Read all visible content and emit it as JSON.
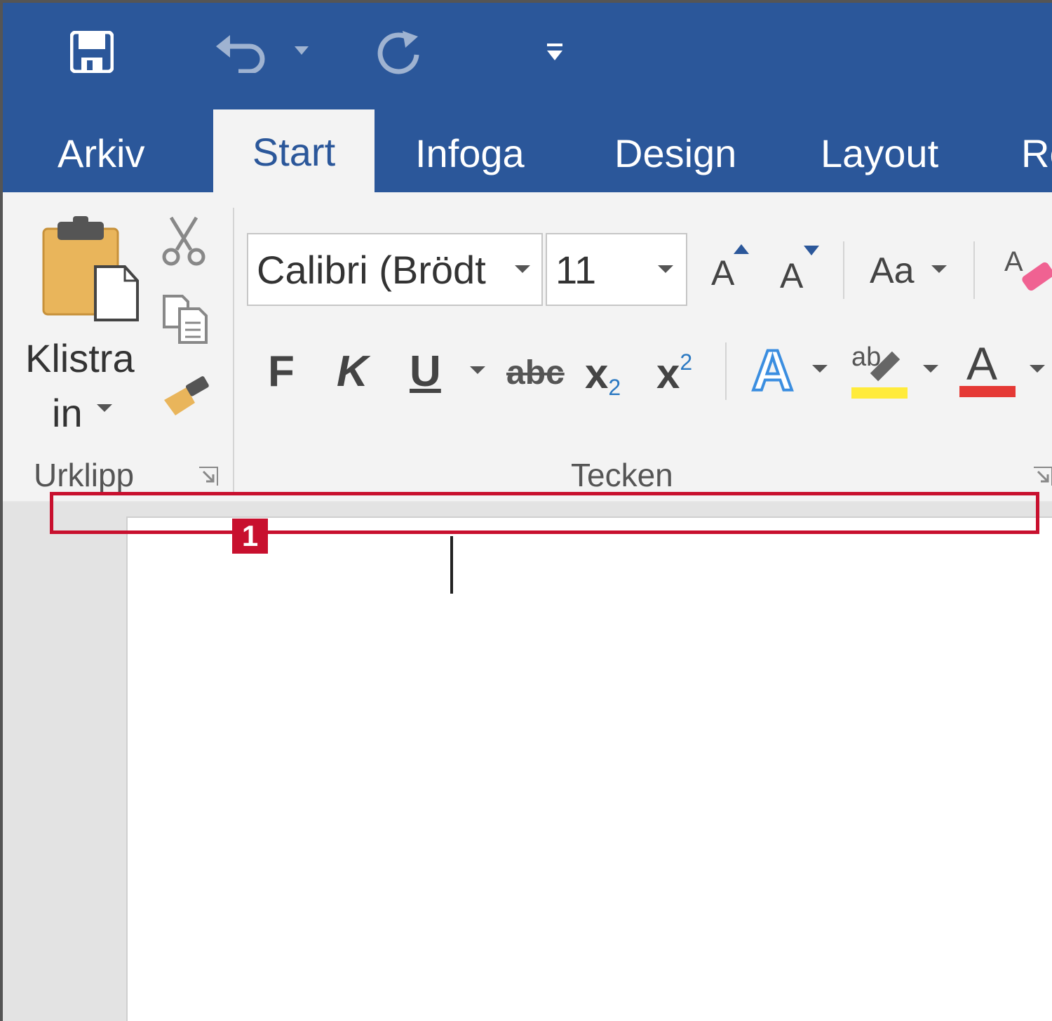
{
  "tabs": {
    "arkiv": "Arkiv",
    "start": "Start",
    "infoga": "Infoga",
    "design": "Design",
    "layout": "Layout",
    "granskning_partial": "Re"
  },
  "clipboard": {
    "paste_line1": "Klistra",
    "paste_line2": "in",
    "group_label": "Urklipp"
  },
  "font": {
    "name": "Calibri (Brödt",
    "size": "11",
    "group_label": "Tecken",
    "case_label": "Aa",
    "bold": "F",
    "italic": "K",
    "underline": "U",
    "strikethrough": "abc",
    "subscript_base": "x",
    "subscript_mark": "2",
    "superscript_base": "x",
    "superscript_mark": "2",
    "grow_label": "A",
    "shrink_label": "A",
    "text_effects_label": "A",
    "highlight_label": "ab",
    "font_color_label": "A"
  },
  "colors": {
    "title_bar": "#2b579a",
    "highlight_yellow": "#ffeb3b",
    "font_color_red": "#e53935",
    "callout_red": "#c8102e"
  },
  "annotation": {
    "callout_number": "1"
  },
  "icons": [
    "save-icon",
    "undo-icon",
    "redo-icon",
    "customize-qat-icon",
    "paste-icon",
    "cut-icon",
    "copy-icon",
    "format-painter-icon",
    "clear-formatting-icon",
    "dialog-launcher-icon"
  ]
}
